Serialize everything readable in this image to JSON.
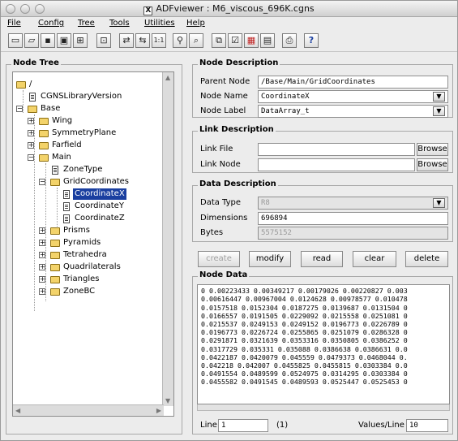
{
  "window": {
    "title": "ADFviewer : M6_viscous_696K.cgns",
    "x_badge": "X"
  },
  "menu": [
    "File",
    "Config",
    "Tree",
    "Tools",
    "Utilities",
    "Help"
  ],
  "toolbar_icons": [
    "new-icon",
    "open-icon",
    "save-icon",
    "save-as-icon",
    "properties-icon",
    "zoom-icon",
    "link-icon",
    "unlink-icon",
    "number-icon",
    "search-icon",
    "find-icon",
    "copy-icon",
    "check-icon",
    "color-icon",
    "grid-icon",
    "print-icon",
    "help-icon"
  ],
  "toolbar_glyphs": {
    "help": "?",
    "number": "1:1"
  },
  "tree": {
    "legend": "Node Tree",
    "nodes": [
      {
        "label": "/",
        "type": "folder"
      },
      {
        "label": "CGNSLibraryVersion",
        "type": "doc"
      },
      {
        "label": "Base",
        "type": "folder"
      },
      {
        "label": "Wing",
        "type": "folder"
      },
      {
        "label": "SymmetryPlane",
        "type": "folder"
      },
      {
        "label": "Farfield",
        "type": "folder"
      },
      {
        "label": "Main",
        "type": "folder"
      },
      {
        "label": "ZoneType",
        "type": "doc"
      },
      {
        "label": "GridCoordinates",
        "type": "folder"
      },
      {
        "label": "CoordinateX",
        "type": "doc"
      },
      {
        "label": "CoordinateY",
        "type": "doc"
      },
      {
        "label": "CoordinateZ",
        "type": "doc"
      },
      {
        "label": "Prisms",
        "type": "folder"
      },
      {
        "label": "Pyramids",
        "type": "folder"
      },
      {
        "label": "Tetrahedra",
        "type": "folder"
      },
      {
        "label": "Quadrilaterals",
        "type": "folder"
      },
      {
        "label": "Triangles",
        "type": "folder"
      },
      {
        "label": "ZoneBC",
        "type": "folder"
      }
    ]
  },
  "node_description": {
    "legend": "Node Description",
    "parent_label": "Parent Node",
    "parent_value": "/Base/Main/GridCoordinates",
    "name_label": "Node Name",
    "name_value": "CoordinateX",
    "label_label": "Node Label",
    "label_value": "DataArray_t"
  },
  "link_description": {
    "legend": "Link Description",
    "file_label": "Link File",
    "file_value": "",
    "node_label": "Link Node",
    "node_value": "",
    "browse": "Browse"
  },
  "data_description": {
    "legend": "Data Description",
    "type_label": "Data Type",
    "type_value": "R8",
    "dimensions_label": "Dimensions",
    "dimensions_value": "696894",
    "bytes_label": "Bytes",
    "bytes_value": "5575152"
  },
  "actions": {
    "create": "create",
    "modify": "modify",
    "read": "read",
    "clear": "clear",
    "delete": "delete"
  },
  "node_data": {
    "legend": "Node Data",
    "lines": [
      "0 0.00223433 0.00349217 0.00179026 0.00220827 0.003",
      "0.00616447 0.00967004 0.0124628 0.00978577 0.010478",
      "0.0157518 0.0152304 0.0187275 0.0139687 0.0131504 0",
      "0.0166557 0.0191505 0.0229092 0.0215558 0.0251081 0",
      "0.0215537 0.0249153 0.0249152 0.0196773 0.0226789 0",
      "0.0196773 0.0226724 0.0255865 0.0251079 0.0286328 0",
      "0.0291871 0.0321639 0.0353316 0.0350805 0.0386252 0",
      "0.0317729 0.035331 0.035088 0.0386638 0.0386631 0.0",
      "0.0422187 0.0420079 0.045559 0.0479373 0.0468044 0.",
      "0.042218 0.042007 0.0455825 0.0455815 0.0303384 0.0",
      "0.0491554 0.0489599 0.0524975 0.0314295 0.0303384 0",
      "0.0455582 0.0491545 0.0489593 0.0525447 0.0525453 0"
    ],
    "line_label": "Line",
    "line_value": "1",
    "line_count": "(1)",
    "values_label": "Values/Line",
    "values_value": "10"
  },
  "accent_colors": {
    "selection": "#1a3fa0",
    "folder": "#f3d36a"
  }
}
